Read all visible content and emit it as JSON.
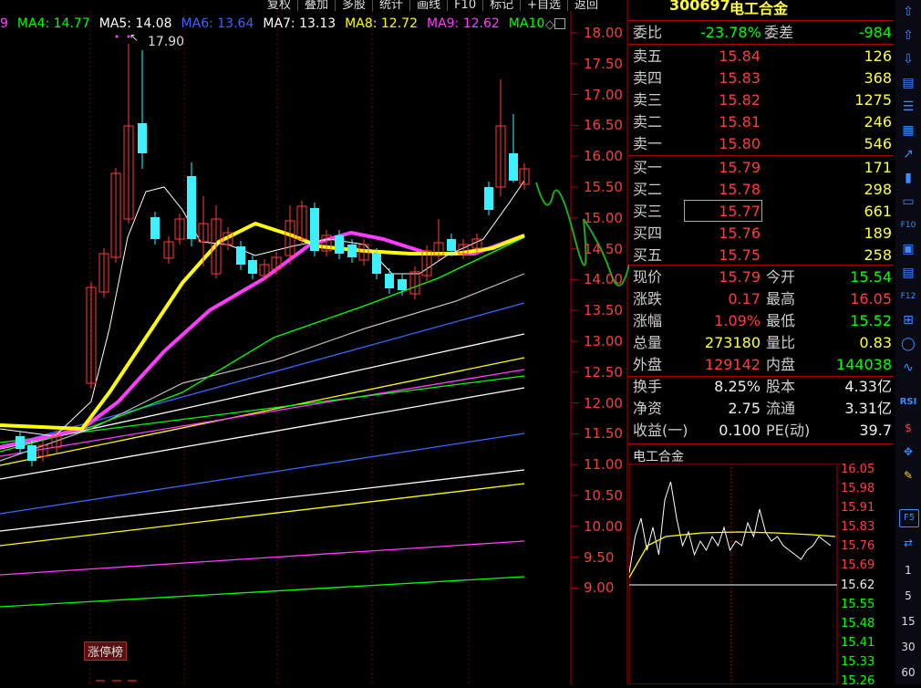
{
  "toolbar": {
    "items": [
      "复权",
      "叠加",
      "多股",
      "统计",
      "画线",
      "F10",
      "标记",
      "+自选",
      "返回"
    ]
  },
  "ma_legend": [
    {
      "label": "9",
      "color": "#ff3cff"
    },
    {
      "label": "MA4: 14.77",
      "color": "#00ff00"
    },
    {
      "label": "MA5: 14.08",
      "color": "#ffffff"
    },
    {
      "label": "MA6: 13.64",
      "color": "#3c64ff"
    },
    {
      "label": "MA7: 13.13",
      "color": "#ffffff"
    },
    {
      "label": "MA8: 12.72",
      "color": "#ffff00"
    },
    {
      "label": "MA9: 12.62",
      "color": "#ff3cff"
    },
    {
      "label": "MA10",
      "color": "#00ff00"
    }
  ],
  "kchart": {
    "high_label": "17.90",
    "y_ticks": [
      "18.00",
      "17.50",
      "17.00",
      "16.50",
      "16.00",
      "15.50",
      "15.00",
      "14.50",
      "14.00",
      "13.50",
      "13.00",
      "12.50",
      "12.00",
      "11.50",
      "11.00",
      "10.50",
      "10.00",
      "9.50",
      "9.00"
    ],
    "tag": "涨停榜",
    "ylim": [
      9.0,
      18.0
    ]
  },
  "panel": {
    "code": "300697",
    "name": "电工合金",
    "weibi_label": "委比",
    "weibi_value": "-23.78%",
    "weicha_label": "委差",
    "weicha_value": "-984",
    "asks": [
      {
        "label": "卖五",
        "price": "15.84",
        "vol": "126"
      },
      {
        "label": "卖四",
        "price": "15.83",
        "vol": "368"
      },
      {
        "label": "卖三",
        "price": "15.82",
        "vol": "1275"
      },
      {
        "label": "卖二",
        "price": "15.81",
        "vol": "246"
      },
      {
        "label": "卖一",
        "price": "15.80",
        "vol": "546"
      }
    ],
    "bids": [
      {
        "label": "买一",
        "price": "15.79",
        "vol": "171"
      },
      {
        "label": "买二",
        "price": "15.78",
        "vol": "298"
      },
      {
        "label": "买三",
        "price": "15.77",
        "vol": "661"
      },
      {
        "label": "买四",
        "price": "15.76",
        "vol": "189"
      },
      {
        "label": "买五",
        "price": "15.75",
        "vol": "258"
      }
    ],
    "stats": [
      {
        "l1": "现价",
        "v1": "15.79",
        "c1": "red",
        "l2": "今开",
        "v2": "15.54",
        "c2": "green"
      },
      {
        "l1": "涨跌",
        "v1": "0.17",
        "c1": "red",
        "l2": "最高",
        "v2": "16.05",
        "c2": "red"
      },
      {
        "l1": "涨幅",
        "v1": "1.09%",
        "c1": "red",
        "l2": "最低",
        "v2": "15.52",
        "c2": "green"
      },
      {
        "l1": "总量",
        "v1": "273180",
        "c1": "yellow",
        "l2": "量比",
        "v2": "0.83",
        "c2": "yellow"
      },
      {
        "l1": "外盘",
        "v1": "129142",
        "c1": "red",
        "l2": "内盘",
        "v2": "144038",
        "c2": "green"
      }
    ],
    "info": [
      {
        "l1": "换手",
        "v1": "8.25%",
        "l2": "股本",
        "v2": "4.33亿"
      },
      {
        "l1": "净资",
        "v1": "2.75",
        "l2": "流通",
        "v2": "3.31亿"
      },
      {
        "l1": "收益(一)",
        "v1": "0.100",
        "l2": "PE(动)",
        "v2": "39.7"
      }
    ],
    "mini_title": "电工合金",
    "mini_axis_up": [
      "16.05",
      "15.98",
      "15.91",
      "15.83",
      "15.76",
      "15.69"
    ],
    "mini_axis_mid": "15.62",
    "mini_axis_down": [
      "15.55",
      "15.48",
      "15.41",
      "15.33",
      "15.26"
    ]
  },
  "right_toolbar": {
    "icons": [
      "up-arrow-icon",
      "up-arrow-icon",
      "down-arrow-icon",
      "report-icon",
      "list-icon",
      "grid-icon",
      "line-chart-icon",
      "candle-icon",
      "document-icon",
      "f10-icon",
      "doc2-icon",
      "doc3-icon",
      "f12-icon",
      "calc-icon",
      "circle-icon",
      "wave-icon"
    ],
    "rsi_label": "RSI",
    "f5_label": "F5",
    "numbers": [
      "1",
      "5",
      "15",
      "30",
      "60"
    ]
  }
}
